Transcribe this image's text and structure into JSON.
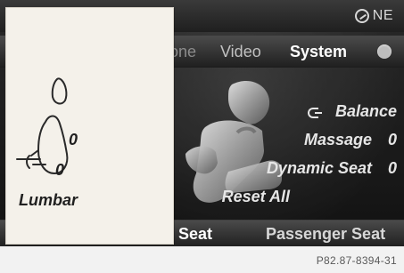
{
  "status": {
    "compass_text": "NE"
  },
  "menu": {
    "items": [
      {
        "label": "one",
        "state": "partial"
      },
      {
        "label": "Video",
        "state": "normal"
      },
      {
        "label": "System",
        "state": "selected"
      }
    ]
  },
  "options": {
    "balance_label": "Balance",
    "massage_label": "Massage",
    "massage_value": "0",
    "dynamic_seat_label": "Dynamic Seat",
    "dynamic_seat_value": "0",
    "reset_all_label": "Reset All"
  },
  "bottom": {
    "seat_tab": "Seat",
    "passenger_seat_tab": "Passenger Seat"
  },
  "lumbar": {
    "value_top": "0",
    "value_bottom": "0",
    "label": "Lumbar"
  },
  "figure_id": "P82.87-8394-31",
  "colors": {
    "screen_bg": "#1a1a1a",
    "panel_bg": "#f4f1ea",
    "text_light": "#e6e6e6",
    "text_dark": "#202020"
  },
  "icons": {
    "compass": "compass-icon",
    "balance": "balance-icon",
    "menu_dot": "menu-dot-icon"
  }
}
